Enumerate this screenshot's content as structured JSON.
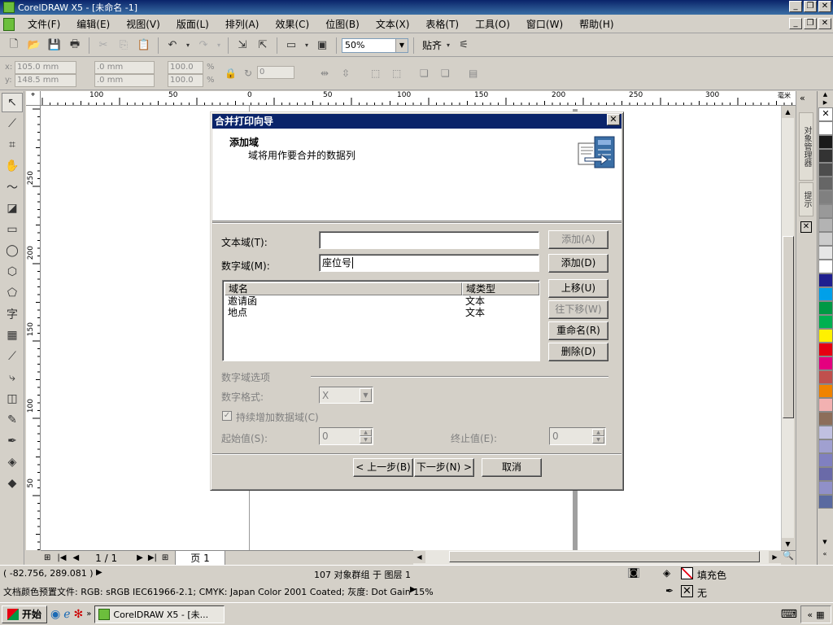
{
  "window": {
    "title": "CorelDRAW X5 - [未命名 -1]"
  },
  "menu": [
    "文件(F)",
    "编辑(E)",
    "视图(V)",
    "版面(L)",
    "排列(A)",
    "效果(C)",
    "位图(B)",
    "文本(X)",
    "表格(T)",
    "工具(O)",
    "窗口(W)",
    "帮助(H)"
  ],
  "toolbar": {
    "zoom": "50%",
    "snap": "贴齐"
  },
  "props": {
    "x_label": "x:",
    "y_label": "y:",
    "x_value": "105.0 mm",
    "y_value": "148.5 mm",
    "w_value": ".0 mm",
    "h_value": ".0 mm",
    "sx": "100.0",
    "sy": "100.0",
    "pct": "%",
    "angle": "0"
  },
  "hruler": {
    "labels": [
      "100",
      "50",
      "0",
      "50",
      "100",
      "150",
      "200",
      "250",
      "300"
    ],
    "unit": "毫米"
  },
  "vruler": {
    "labels": [
      "250",
      "200",
      "150",
      "100",
      "50"
    ]
  },
  "pagenav": {
    "current": "1 / 1",
    "tab": "页 1"
  },
  "dock": {
    "tab1": "对象管理器",
    "tab2": "提示"
  },
  "palette": [
    "#ffffff",
    "#1a1a1a",
    "#333333",
    "#4d4d4d",
    "#666666",
    "#808080",
    "#999999",
    "#b3b3b3",
    "#cccccc",
    "#e6e6e6",
    "#ffffff",
    "#1f1f8f",
    "#00a0e9",
    "#009944",
    "#00b050",
    "#fff100",
    "#e60012",
    "#e4007f",
    "#c0504d",
    "#f08300",
    "#f2b1b1",
    "#8c6e5a",
    "#c0c0e0",
    "#a0a0d0",
    "#8080c0",
    "#6a6aa8",
    "#9090c8",
    "#5a6aa0"
  ],
  "status": {
    "coords": "( -82.756, 289.081 )",
    "objects": "107 对象群组 于 图层 1",
    "fill_label": "填充色",
    "outline_label": "无",
    "profile": "文档颜色预置文件: RGB: sRGB IEC61966-2.1; CMYK: Japan Color 2001 Coated; 灰度: Dot Gain 15%"
  },
  "taskbar": {
    "start": "开始",
    "task": "CorelDRAW X5 - [未..."
  },
  "dialog": {
    "title": "合并打印向导",
    "heading": "添加域",
    "subheading": "域将用作要合并的数据列",
    "text_field_label": "文本域(T):",
    "text_field_value": "",
    "number_field_label": "数字域(M):",
    "number_field_value": "座位号",
    "add_text_btn": "添加(A)",
    "add_num_btn": "添加(D)",
    "list_headers": [
      "域名",
      "域类型"
    ],
    "list_rows": [
      [
        "邀请函",
        "文本"
      ],
      [
        "地点",
        "文本"
      ]
    ],
    "move_up": "上移(U)",
    "move_down": "往下移(W)",
    "rename": "重命名(R)",
    "delete": "删除(D)",
    "num_options": "数字域选项",
    "num_format_label": "数字格式:",
    "num_format_value": "X",
    "continuous": "持续增加数据域(C)",
    "start_label": "起始值(S):",
    "start_value": "0",
    "end_label": "终止值(E):",
    "end_value": "0",
    "back": "< 上一步(B)",
    "next": "下一步(N) >",
    "cancel": "取消"
  }
}
